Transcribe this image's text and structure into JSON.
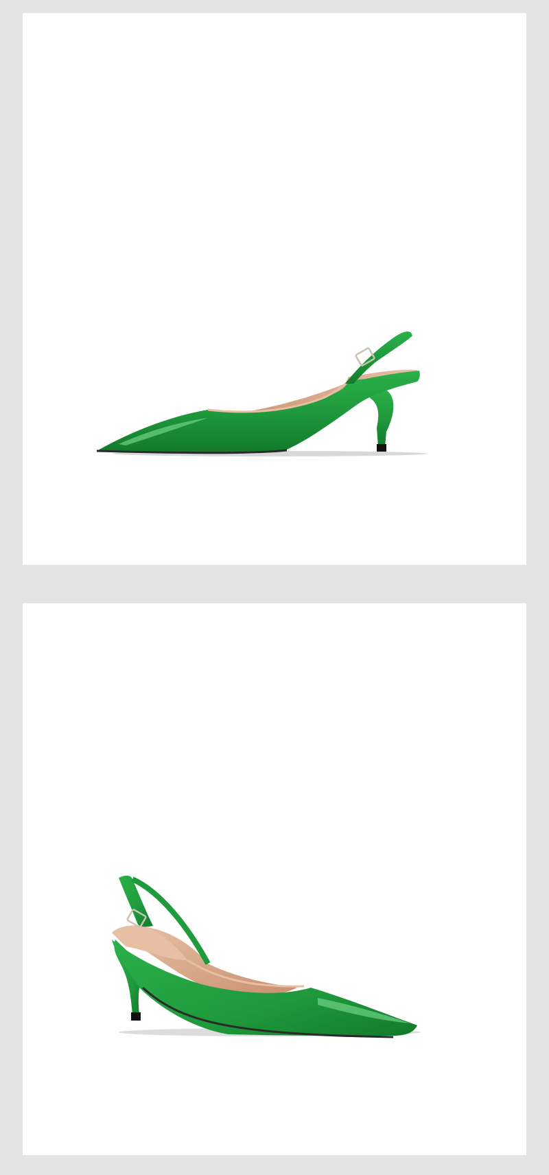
{
  "colors": {
    "page_background": "#e3e3e3",
    "panel_background": "#ffffff",
    "patent_green": "#1f9a3c",
    "green_dark": "#137a2b",
    "green_highlight": "#6fd186",
    "lining_tan": "#d9a98a",
    "sole_edge": "#2a2a2a",
    "heel_tip": "#111111",
    "buckle": "#c9c2b2"
  },
  "panels": [
    {
      "view": "side-profile",
      "subject": "green-patent-slingback-pump"
    },
    {
      "view": "three-quarter-front",
      "subject": "green-patent-slingback-pump"
    }
  ]
}
